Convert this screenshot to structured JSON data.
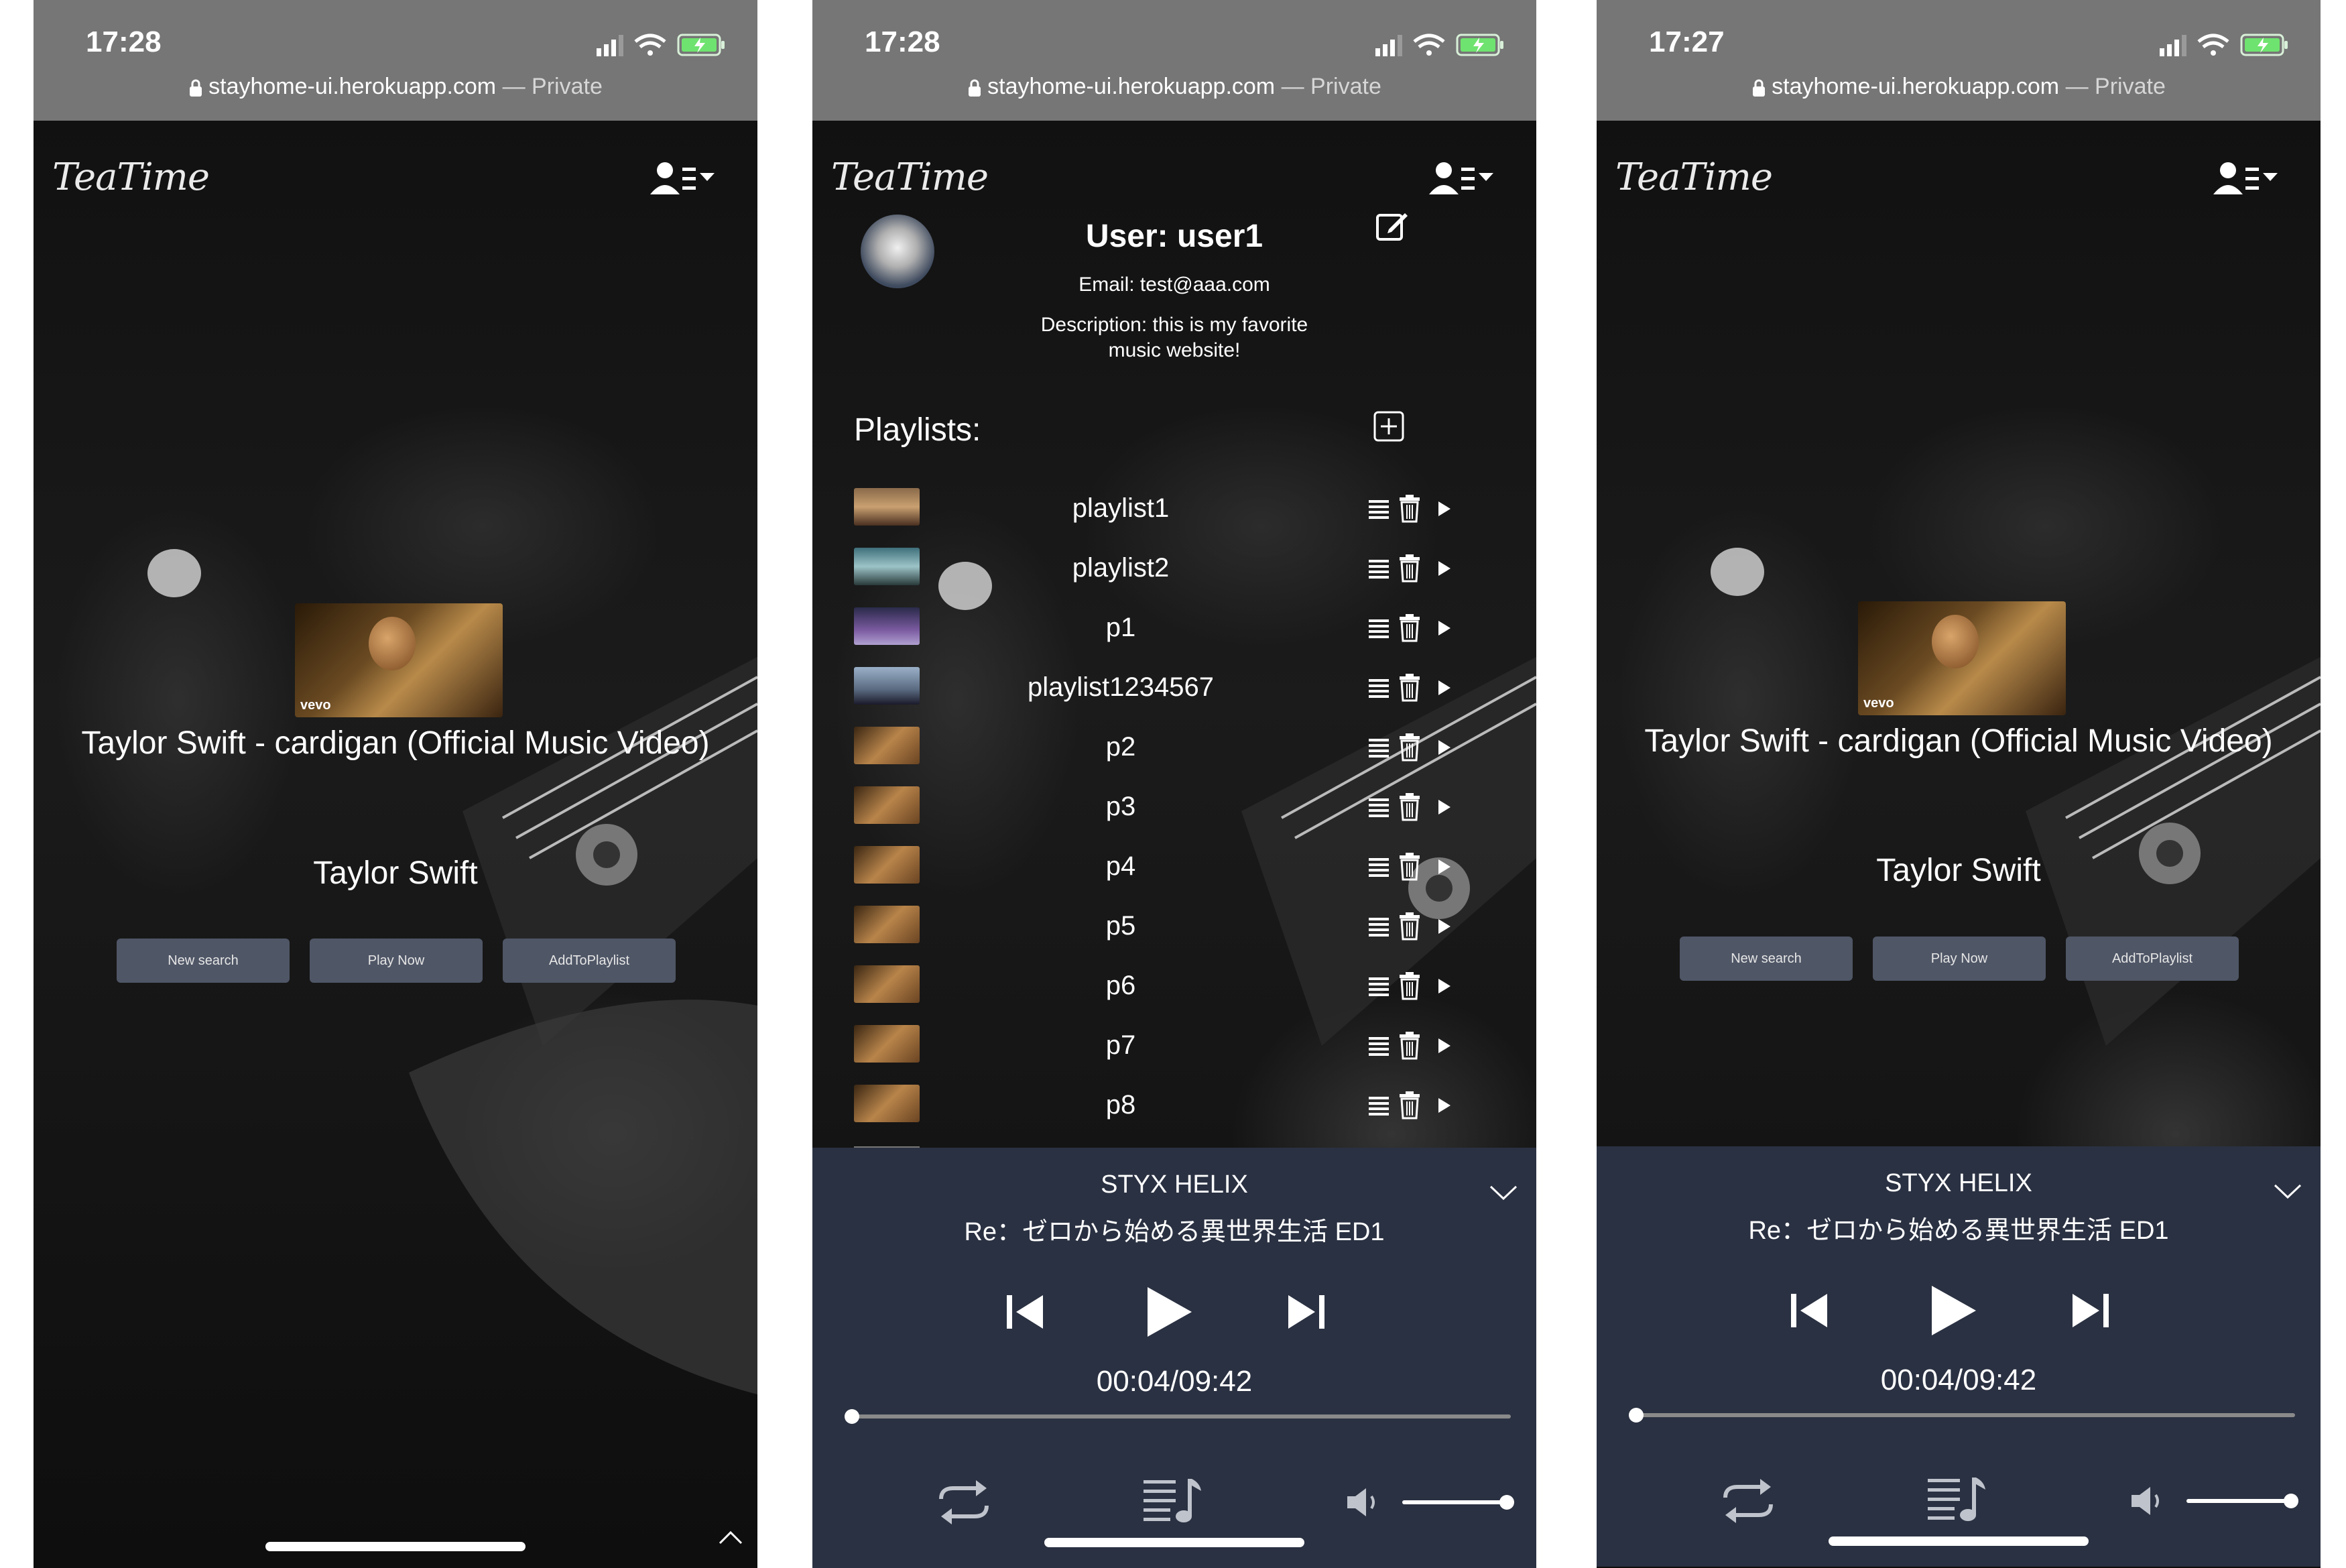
{
  "status_bar": {
    "screens": [
      {
        "time": "17:28",
        "domain": "stayhome-ui.herokuapp.com",
        "privacy": "— Private"
      },
      {
        "time": "17:28",
        "domain": "stayhome-ui.herokuapp.com",
        "privacy": "— Private"
      },
      {
        "time": "17:27",
        "domain": "stayhome-ui.herokuapp.com",
        "privacy": "— Private"
      }
    ]
  },
  "app": {
    "logo": "TeaTime"
  },
  "search_result": {
    "title": "Taylor Swift - cardigan (Official Music Video)",
    "artist": "Taylor Swift",
    "thumbnail_badge": "vevo",
    "buttons": {
      "new_search": "New search",
      "play_now": "Play Now",
      "add_to_playlist": "AddToPlaylist"
    }
  },
  "profile": {
    "title": "User: user1",
    "email": "Email: test@aaa.com",
    "description": "Description: this is my favorite music website!",
    "playlists_heading": "Playlists:",
    "playlists": [
      {
        "name": "playlist1"
      },
      {
        "name": "playlist2"
      },
      {
        "name": "p1"
      },
      {
        "name": "playlist1234567"
      },
      {
        "name": "p2"
      },
      {
        "name": "p3"
      },
      {
        "name": "p4"
      },
      {
        "name": "p5"
      },
      {
        "name": "p6"
      },
      {
        "name": "p7"
      },
      {
        "name": "p8"
      }
    ]
  },
  "player": {
    "title": "STYX HELIX",
    "subtitle": "Re：ゼロから始める異世界生活 ED1",
    "time": "00:04/09:42",
    "progress_fraction": 0.007,
    "volume_fraction": 1.0
  },
  "icons": {
    "status": [
      "signal-icon",
      "wifi-icon",
      "battery-icon"
    ],
    "lock": "lock-icon",
    "user_menu": "user-menu-icon",
    "edit": "edit-icon",
    "add": "add-playlist-icon",
    "playlist_actions": [
      "list-icon",
      "trash-icon",
      "play-icon"
    ],
    "player": [
      "previous-icon",
      "play-icon",
      "next-icon",
      "repeat-icon",
      "queue-icon",
      "volume-icon",
      "collapse-icon"
    ]
  },
  "colors": {
    "player_bg": "#2a3142",
    "button_bg": "#4f5666",
    "status_bar_bg": "#767676",
    "battery": "#6fe36f"
  }
}
